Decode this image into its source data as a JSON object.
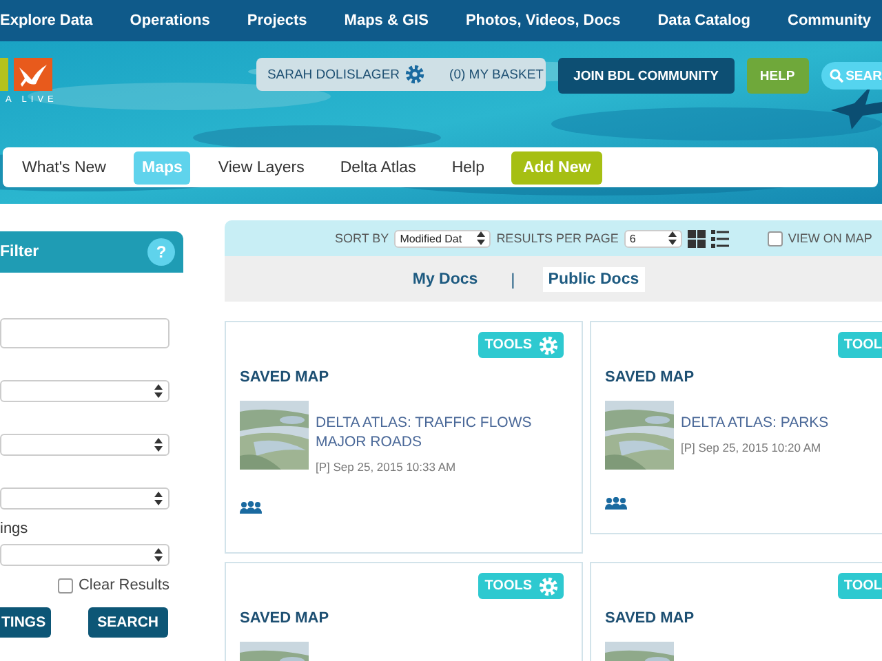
{
  "top_nav": [
    {
      "label": "Explore Data"
    },
    {
      "label": "Operations"
    },
    {
      "label": "Projects"
    },
    {
      "label": "Maps & GIS"
    },
    {
      "label": "Photos, Videos, Docs"
    },
    {
      "label": "Data Catalog"
    },
    {
      "label": "Community"
    }
  ],
  "logo": {
    "text": "A LIVE"
  },
  "user_bar": {
    "user": "SARAH DOLISLAGER",
    "basket": "(0) MY BASKET"
  },
  "header_buttons": [
    {
      "label": "JOIN BDL COMMUNITY",
      "kind": "dark"
    },
    {
      "label": "HELP",
      "kind": "green"
    }
  ],
  "search": {
    "label": "SEAR"
  },
  "sub_nav": [
    {
      "label": "What's New",
      "kind": "link",
      "selected": false
    },
    {
      "label": "Maps",
      "kind": "link",
      "selected": true
    },
    {
      "label": "View Layers",
      "kind": "link",
      "selected": false
    },
    {
      "label": "Delta Atlas",
      "kind": "link",
      "selected": false
    },
    {
      "label": "Help",
      "kind": "link",
      "selected": false
    },
    {
      "label": "Add New",
      "kind": "action",
      "selected": false
    }
  ],
  "filter": {
    "title": "Filter",
    "help": "?",
    "fields": [
      {
        "kind": "input"
      },
      {
        "kind": "select"
      },
      {
        "kind": "select"
      },
      {
        "kind": "select"
      },
      {
        "kind": "select",
        "label": "ings"
      }
    ],
    "clear_results": {
      "label": "Clear Results",
      "checked": false
    },
    "buttons": [
      "TINGS",
      "SEARCH"
    ]
  },
  "toolbar": {
    "sort_label": "SORT BY",
    "sort_value": "Modified Dat",
    "per_page_label": "RESULTS PER PAGE",
    "per_page_value": "6",
    "view_on_map": {
      "label": "VIEW ON MAP",
      "checked": false
    }
  },
  "doc_tabs": {
    "separator": "|",
    "tabs": [
      {
        "label": "My Docs",
        "selected": false
      },
      {
        "label": "Public Docs",
        "selected": true
      }
    ]
  },
  "cards": [
    {
      "tools": "TOOLS",
      "type": "SAVED MAP",
      "title": "DELTA ATLAS: TRAFFIC FLOWS MAJOR ROADS",
      "date": "[P] Sep 25, 2015 10:33 AM",
      "shared": true
    },
    {
      "tools": "TOOL",
      "type": "SAVED MAP",
      "title": "DELTA ATLAS: PARKS",
      "date": "[P] Sep 25, 2015 10:20 AM",
      "shared": true
    },
    {
      "tools": "TOOLS",
      "type": "SAVED MAP"
    },
    {
      "tools": "TOOL",
      "type": "SAVED MAP"
    }
  ]
}
